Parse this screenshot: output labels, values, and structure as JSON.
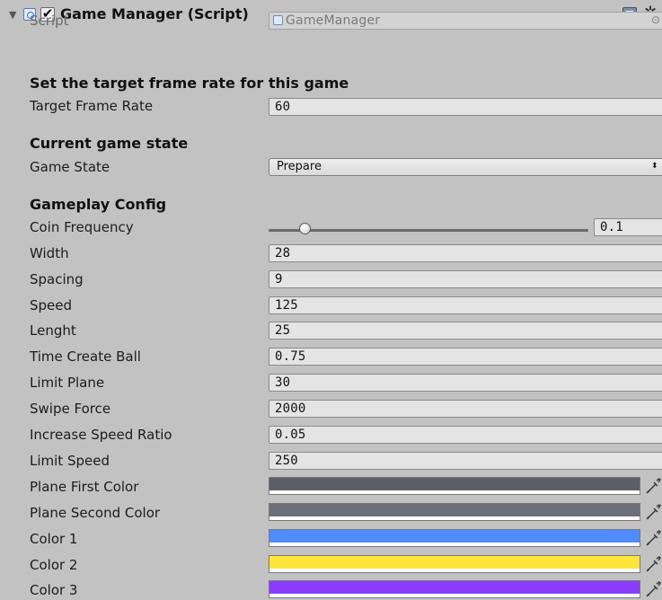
{
  "header": {
    "title": "Game Manager (Script)",
    "enabled": true
  },
  "script_row": {
    "label": "Script",
    "value": "GameManager"
  },
  "sections": {
    "frame": "Set the target frame rate for this game",
    "state": "Current game state",
    "config": "Gameplay Config"
  },
  "fields": {
    "target_frame_rate": {
      "label": "Target Frame Rate",
      "value": "60"
    },
    "game_state": {
      "label": "Game State",
      "value": "Prepare"
    },
    "coin_frequency": {
      "label": "Coin Frequency",
      "value": "0.1",
      "slider_fraction": 0.1
    },
    "width": {
      "label": "Width",
      "value": "28"
    },
    "spacing": {
      "label": "Spacing",
      "value": "9"
    },
    "speed": {
      "label": "Speed",
      "value": "125"
    },
    "lenght": {
      "label": "Lenght",
      "value": "25"
    },
    "time_create_ball": {
      "label": "Time Create Ball",
      "value": "0.75"
    },
    "limit_plane": {
      "label": "Limit Plane",
      "value": "30"
    },
    "swipe_force": {
      "label": "Swipe Force",
      "value": "2000"
    },
    "increase_speed_ratio": {
      "label": "Increase Speed Ratio",
      "value": "0.05"
    },
    "limit_speed": {
      "label": "Limit Speed",
      "value": "250"
    }
  },
  "colors": {
    "plane_first": {
      "label": "Plane First Color",
      "hex": "#5b5e68"
    },
    "plane_second": {
      "label": "Plane Second Color",
      "hex": "#6c6f78"
    },
    "color1": {
      "label": "Color 1",
      "hex": "#4f8dff"
    },
    "color2": {
      "label": "Color 2",
      "hex": "#ffe43a"
    },
    "color3": {
      "label": "Color 3",
      "hex": "#8b3cff"
    }
  },
  "icons": {
    "foldout": "foldout-expanded-icon",
    "script": "csharp-script-icon",
    "help": "help-book-icon",
    "settings": "gear-icon",
    "object_picker": "object-picker-icon",
    "dropdown": "dropdown-arrows-icon",
    "eyedropper": "eyedropper-icon"
  }
}
